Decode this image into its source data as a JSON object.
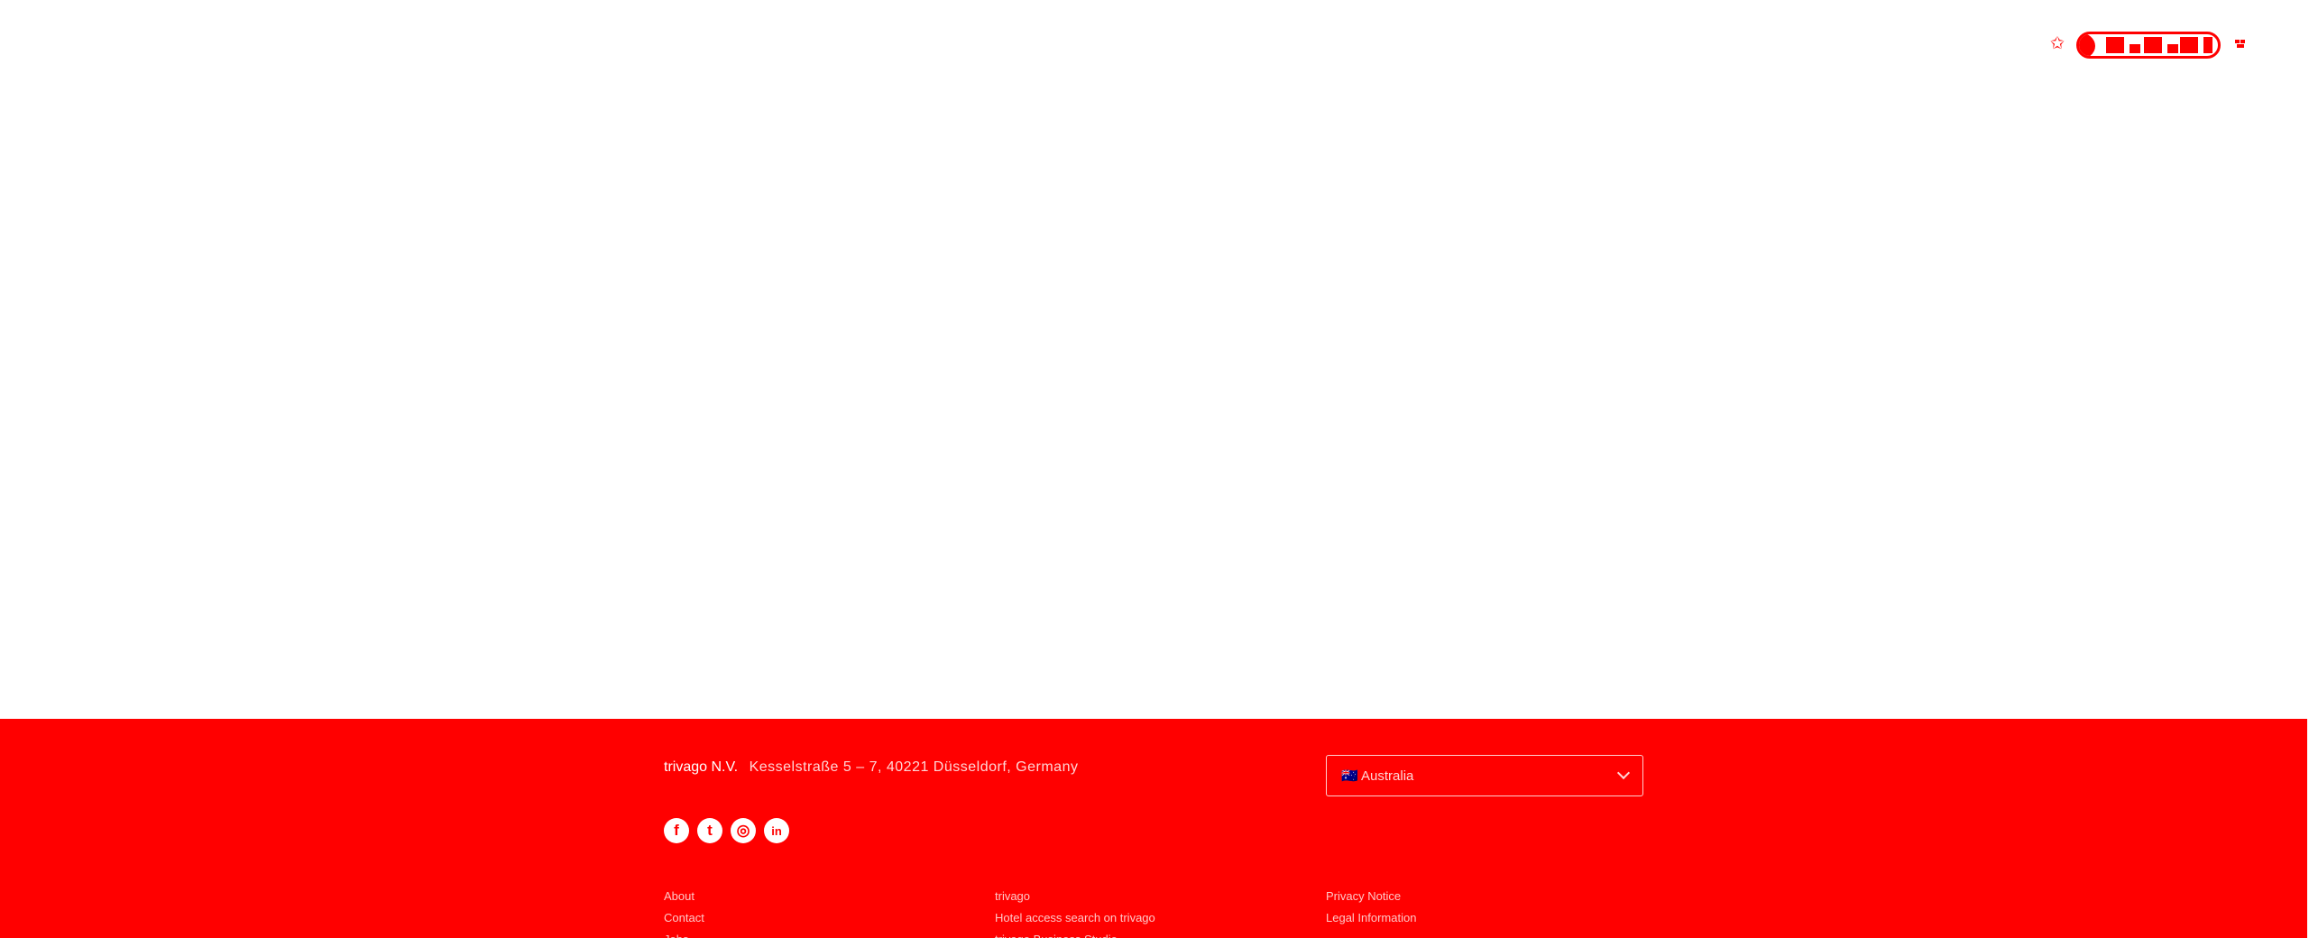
{
  "brand": {
    "accent_color": "#ff0000",
    "badge_icons": [
      "star-icon",
      "pill-logo",
      "mini-logo-icon"
    ]
  },
  "footer": {
    "background_color": "#ff0000",
    "company_name": "trivago N.V.",
    "company_address": "Kesselstraße 5 – 7, 40221 Düsseldorf, Germany",
    "social": [
      {
        "icon": "facebook-icon",
        "glyph": "f"
      },
      {
        "icon": "twitter-icon",
        "glyph": "t"
      },
      {
        "icon": "instagram-icon",
        "glyph": "◎"
      },
      {
        "icon": "linkedin-icon",
        "glyph": "in"
      }
    ],
    "country_select": {
      "value": "🇦🇺 Australia"
    },
    "links": {
      "col1": [
        "About",
        "Contact",
        "Jobs"
      ],
      "col2": [
        "trivago",
        "Hotel access search on trivago",
        "trivago Business Studio"
      ],
      "col3": [
        "Privacy Notice",
        "Legal Information"
      ]
    }
  }
}
